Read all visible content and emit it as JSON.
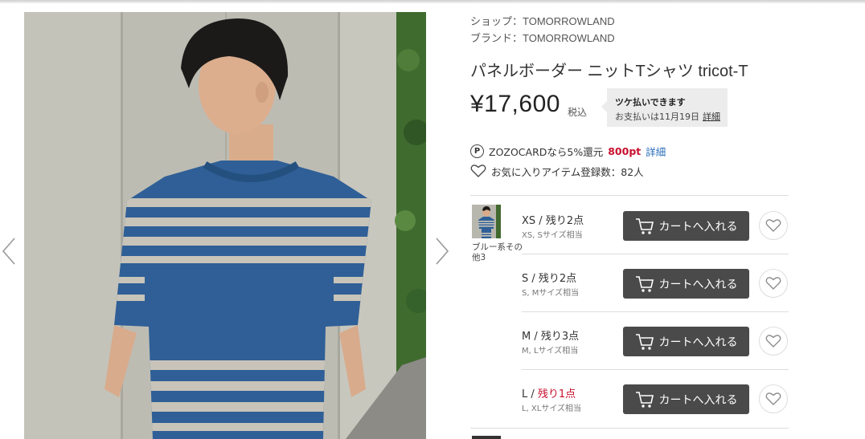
{
  "product": {
    "shop_label": "ショップ：",
    "shop_name": "TOMORROWLAND",
    "brand_label": "ブランド：",
    "brand_name": "TOMORROWLAND",
    "title": "パネルボーダー ニットTシャツ tricot-T",
    "price": "¥17,600",
    "tax_label": "税込"
  },
  "pay_later": {
    "line1": "ツケ払いできます",
    "line2": "お支払いは11月19日",
    "detail_link": "詳細"
  },
  "points": {
    "icon_letter": "P",
    "text": "ZOZOCARDなら5%還元",
    "amount": "800pt",
    "detail_link": "詳細"
  },
  "favorites": {
    "text": "お気に入りアイテム登録数：82人"
  },
  "color_variant": {
    "name": "ブルー系その他3"
  },
  "sizes": [
    {
      "label": "XS / 残り2点",
      "label_main": "XS / ",
      "stock": "残り2点",
      "low_stock": false,
      "note": "XS, Sサイズ相当",
      "cart_label": "カートへ入れる"
    },
    {
      "label": "S / 残り2点",
      "label_main": "S / ",
      "stock": "残り2点",
      "low_stock": false,
      "note": "S, Mサイズ相当",
      "cart_label": "カートへ入れる"
    },
    {
      "label": "M / 残り3点",
      "label_main": "M / ",
      "stock": "残り3点",
      "low_stock": false,
      "note": "M, Lサイズ相当",
      "cart_label": "カートへ入れる"
    },
    {
      "label": "L / 残り1点",
      "label_main": "L / ",
      "stock": "残り1点",
      "low_stock": true,
      "note": "L, XLサイズ相当",
      "cart_label": "カートへ入れる"
    }
  ],
  "icons": {
    "prev": "chevron-left-icon",
    "next": "chevron-right-icon",
    "cart": "cart-icon",
    "heart": "heart-icon",
    "points": "points-icon"
  },
  "colors": {
    "low_stock": "#c8102e",
    "points_amount": "#c8102e",
    "link": "#2a6ebb",
    "cart_button": "#4a4a4a"
  }
}
